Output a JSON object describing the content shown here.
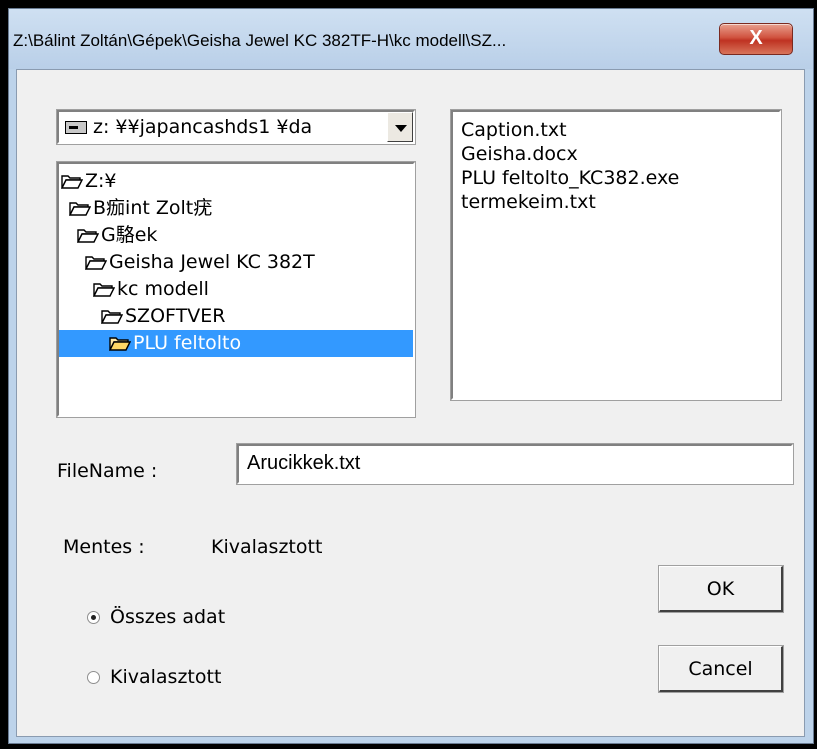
{
  "window": {
    "title": "Z:\\Bálint Zoltán\\Gépek\\Geisha Jewel KC 382TF-H\\kc modell\\SZ...",
    "close_symbol": "X"
  },
  "drive_select": {
    "value": "z: ¥¥japancashds1 ¥da",
    "icon": "drive-icon",
    "arrow_icon": "chevron-down-icon"
  },
  "folder_tree": {
    "items": [
      {
        "label": "Z:¥"
      },
      {
        "label": "B痂int Zolt疣"
      },
      {
        "label": "G駱ek"
      },
      {
        "label": "Geisha Jewel KC 382T"
      },
      {
        "label": "kc modell"
      },
      {
        "label": "SZOFTVER"
      },
      {
        "label": "PLU feltolto"
      }
    ],
    "selected_index": 6
  },
  "file_list": {
    "items": [
      "Caption.txt",
      "Geisha.docx",
      "PLU feltolto_KC382.exe",
      "termekeim.txt"
    ]
  },
  "filename": {
    "label": "FileName :",
    "value": "Arucikkek.txt"
  },
  "mentes": {
    "label": "Mentes :",
    "value": "Kivalasztott"
  },
  "radios": [
    {
      "label": "Összes adat",
      "checked": true
    },
    {
      "label": "Kivalasztott",
      "checked": false
    }
  ],
  "buttons": {
    "ok": "OK",
    "cancel": "Cancel"
  },
  "colors": {
    "selection": "#3399ff",
    "close_button": "#c8402c",
    "frame": "#bdd3ea"
  }
}
